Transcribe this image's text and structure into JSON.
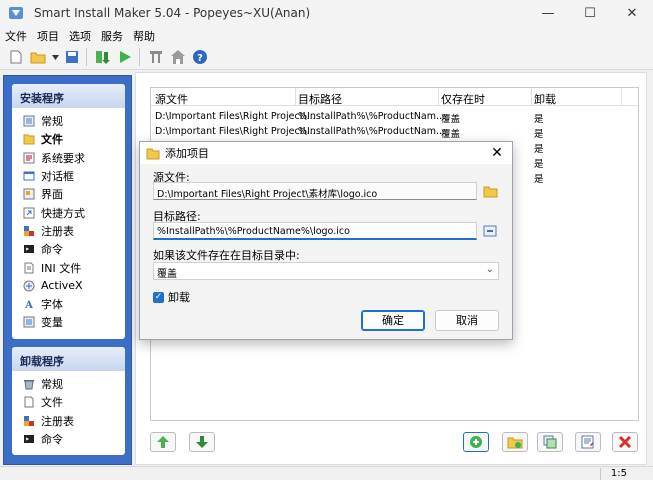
{
  "window": {
    "title": "Smart Install Maker 5.04 - Popeyes~XU(Anan)",
    "minimize": "—",
    "maximize": "☐",
    "close": "✕"
  },
  "menu": [
    "文件",
    "项目",
    "选项",
    "服务",
    "帮助"
  ],
  "sidebar": {
    "install": {
      "title": "安装程序",
      "items": [
        "常规",
        "文件",
        "系统要求",
        "对话框",
        "界面",
        "快捷方式",
        "注册表",
        "命令",
        "INI 文件",
        "ActiveX",
        "字体",
        "变量"
      ],
      "active_index": 1
    },
    "uninstall": {
      "title": "卸载程序",
      "items": [
        "常规",
        "文件",
        "注册表",
        "命令"
      ]
    }
  },
  "filelist": {
    "columns": [
      "源文件",
      "目标路径",
      "仅存在时",
      "卸载"
    ],
    "rows": [
      [
        "D:\\Important Files\\Right Project\\...",
        "%InstallPath%\\%ProductNam...",
        "覆盖",
        "是"
      ],
      [
        "D:\\Important Files\\Right Project\\...",
        "%InstallPath%\\%ProductNam...",
        "覆盖",
        "是"
      ],
      [
        "",
        "",
        "",
        "是"
      ],
      [
        "",
        "",
        "",
        "是"
      ],
      [
        "",
        "",
        "",
        "是"
      ]
    ]
  },
  "status": {
    "position": "1:5"
  },
  "dialog": {
    "title": "添加项目",
    "close": "✕",
    "source_label": "源文件:",
    "source_value": "D:\\Important Files\\Right Project\\素材库\\logo.ico",
    "target_label": "目标路径:",
    "target_value": "%InstallPath%\\%ProductName%\\logo.ico",
    "exists_label": "如果该文件存在在目标目录中:",
    "exists_value": "覆盖",
    "uninstall_label": "卸载",
    "uninstall_checked": true,
    "ok_label": "确定",
    "cancel_label": "取消"
  }
}
